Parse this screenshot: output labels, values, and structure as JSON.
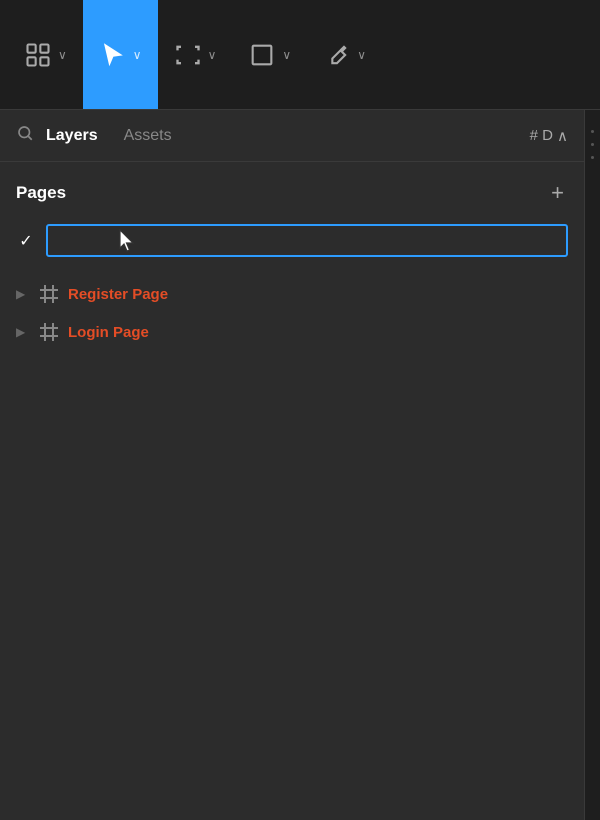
{
  "toolbar": {
    "tools": [
      {
        "id": "grid",
        "label": "grid-tool",
        "active": false
      },
      {
        "id": "move",
        "label": "move-tool",
        "active": true
      },
      {
        "id": "frame",
        "label": "frame-tool",
        "active": false
      },
      {
        "id": "shape",
        "label": "shape-tool",
        "active": false
      },
      {
        "id": "pen",
        "label": "pen-tool",
        "active": false
      }
    ]
  },
  "panel": {
    "search_icon": "🔍",
    "layers_tab": "Layers",
    "assets_tab": "Assets",
    "shortcut": "# D",
    "chevron": "∧"
  },
  "pages": {
    "title": "Pages",
    "add_label": "+",
    "active_page": {
      "check": "✓",
      "placeholder": ""
    },
    "items": [
      {
        "label": "Register Page",
        "color": "#e44d26"
      },
      {
        "label": "Login Page",
        "color": "#e44d26"
      }
    ]
  }
}
